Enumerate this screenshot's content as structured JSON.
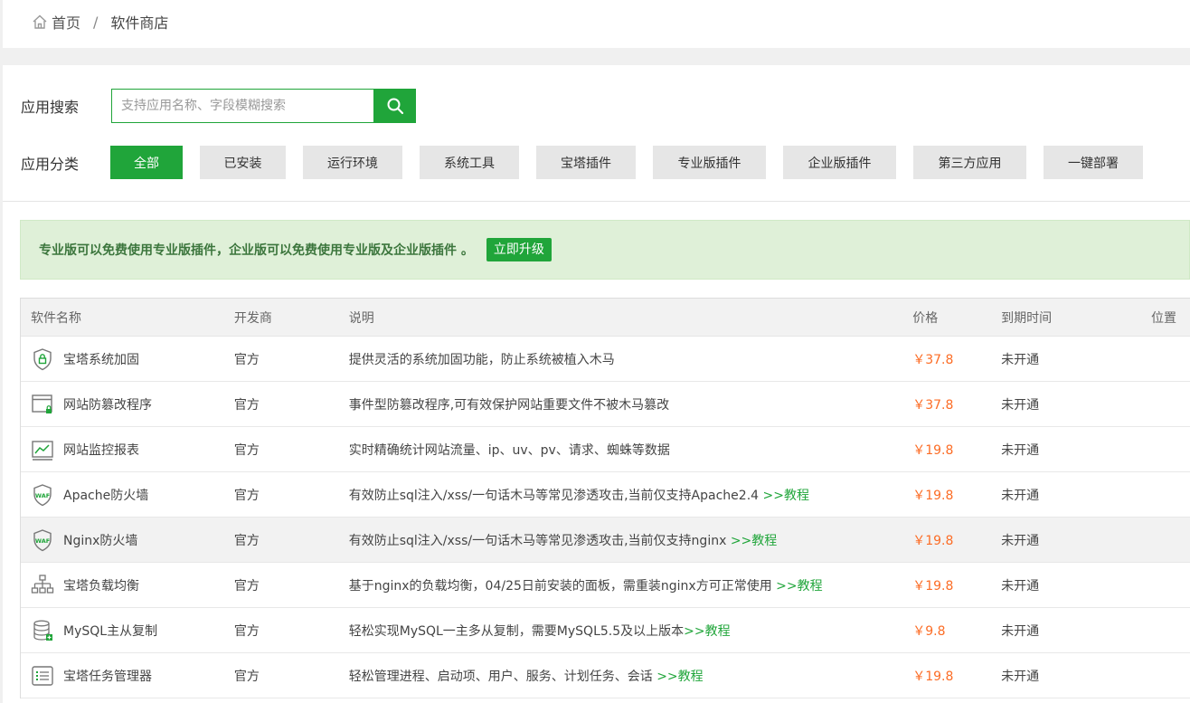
{
  "breadcrumb": {
    "home": "首页",
    "separator": "/",
    "current": "软件商店"
  },
  "search": {
    "label": "应用搜索",
    "placeholder": "支持应用名称、字段模糊搜索"
  },
  "category": {
    "label": "应用分类",
    "items": [
      "全部",
      "已安装",
      "运行环境",
      "系统工具",
      "宝塔插件",
      "专业版插件",
      "企业版插件",
      "第三方应用",
      "一键部署"
    ],
    "active_index": 0
  },
  "notice": {
    "text": "专业版可以免费使用专业版插件，企业版可以免费使用专业版及企业版插件 。",
    "button": "立即升级"
  },
  "table": {
    "headers": {
      "name": "软件名称",
      "developer": "开发商",
      "description": "说明",
      "price": "价格",
      "expire": "到期时间",
      "position": "位置"
    },
    "rows": [
      {
        "icon": "shield-lock-icon",
        "name": "宝塔系统加固",
        "developer": "官方",
        "description": "提供灵活的系统加固功能，防止系统被植入木马",
        "tutorial": "",
        "price": "￥37.8",
        "expire": "未开通"
      },
      {
        "icon": "webpage-lock-icon",
        "name": "网站防篡改程序",
        "developer": "官方",
        "description": "事件型防篡改程序,可有效保护网站重要文件不被木马篡改",
        "tutorial": "",
        "price": "￥37.8",
        "expire": "未开通"
      },
      {
        "icon": "monitor-chart-icon",
        "name": "网站监控报表",
        "developer": "官方",
        "description": "实时精确统计网站流量、ip、uv、pv、请求、蜘蛛等数据",
        "tutorial": "",
        "price": "￥19.8",
        "expire": "未开通"
      },
      {
        "icon": "waf-shield-icon",
        "name": "Apache防火墙",
        "developer": "官方",
        "description": "有效防止sql注入/xss/一句话木马等常见渗透攻击,当前仅支持Apache2.4 ",
        "tutorial": ">>教程",
        "price": "￥19.8",
        "expire": "未开通"
      },
      {
        "icon": "waf-shield-icon",
        "name": "Nginx防火墙",
        "developer": "官方",
        "description": "有效防止sql注入/xss/一句话木马等常见渗透攻击,当前仅支持nginx ",
        "tutorial": ">>教程",
        "price": "￥19.8",
        "expire": "未开通"
      },
      {
        "icon": "network-tree-icon",
        "name": "宝塔负载均衡",
        "developer": "官方",
        "description": "基于nginx的负载均衡，04/25日前安装的面板，需重装nginx方可正常使用 ",
        "tutorial": ">>教程",
        "price": "￥19.8",
        "expire": "未开通"
      },
      {
        "icon": "database-icon",
        "name": "MySQL主从复制",
        "developer": "官方",
        "description": "轻松实现MySQL一主多从复制，需要MySQL5.5及以上版本",
        "tutorial": ">>教程",
        "price": "￥9.8",
        "expire": "未开通"
      },
      {
        "icon": "task-list-icon",
        "name": "宝塔任务管理器",
        "developer": "官方",
        "description": "轻松管理进程、启动项、用户、服务、计划任务、会话 ",
        "tutorial": ">>教程",
        "price": "￥19.8",
        "expire": "未开通"
      }
    ]
  },
  "colors": {
    "accent": "#20a53a",
    "price": "#fc6d26",
    "notice_bg": "#dff0d8"
  }
}
